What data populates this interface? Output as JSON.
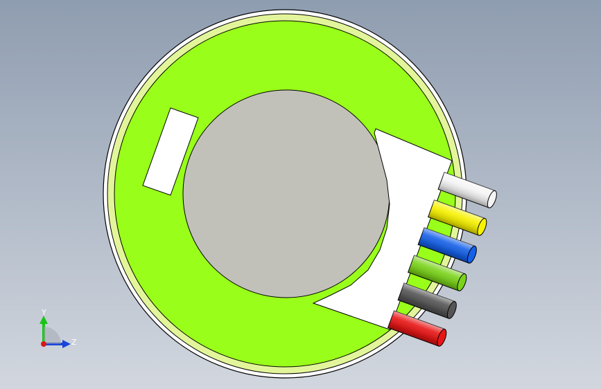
{
  "viewport": {
    "background_top": "#8f9db0",
    "background_bottom": "#d2d7df"
  },
  "model": {
    "board_color": "#99ff1a",
    "rim_color": "#e3f59a",
    "hub_color": "#c2c1b9",
    "connector_color": "#ffffff",
    "pad_color": "#ffffff",
    "wires": [
      {
        "name": "white",
        "color": "#f4f4f4"
      },
      {
        "name": "yellow",
        "color": "#f7f200"
      },
      {
        "name": "blue",
        "color": "#1560e8"
      },
      {
        "name": "green",
        "color": "#7ad31a"
      },
      {
        "name": "black",
        "color": "#555555"
      },
      {
        "name": "red",
        "color": "#e81515"
      }
    ]
  },
  "triad": {
    "y_label": "Y",
    "z_label": "Z",
    "y_color": "#18c418",
    "z_color": "#1844d8",
    "x_color": "#d81818"
  }
}
